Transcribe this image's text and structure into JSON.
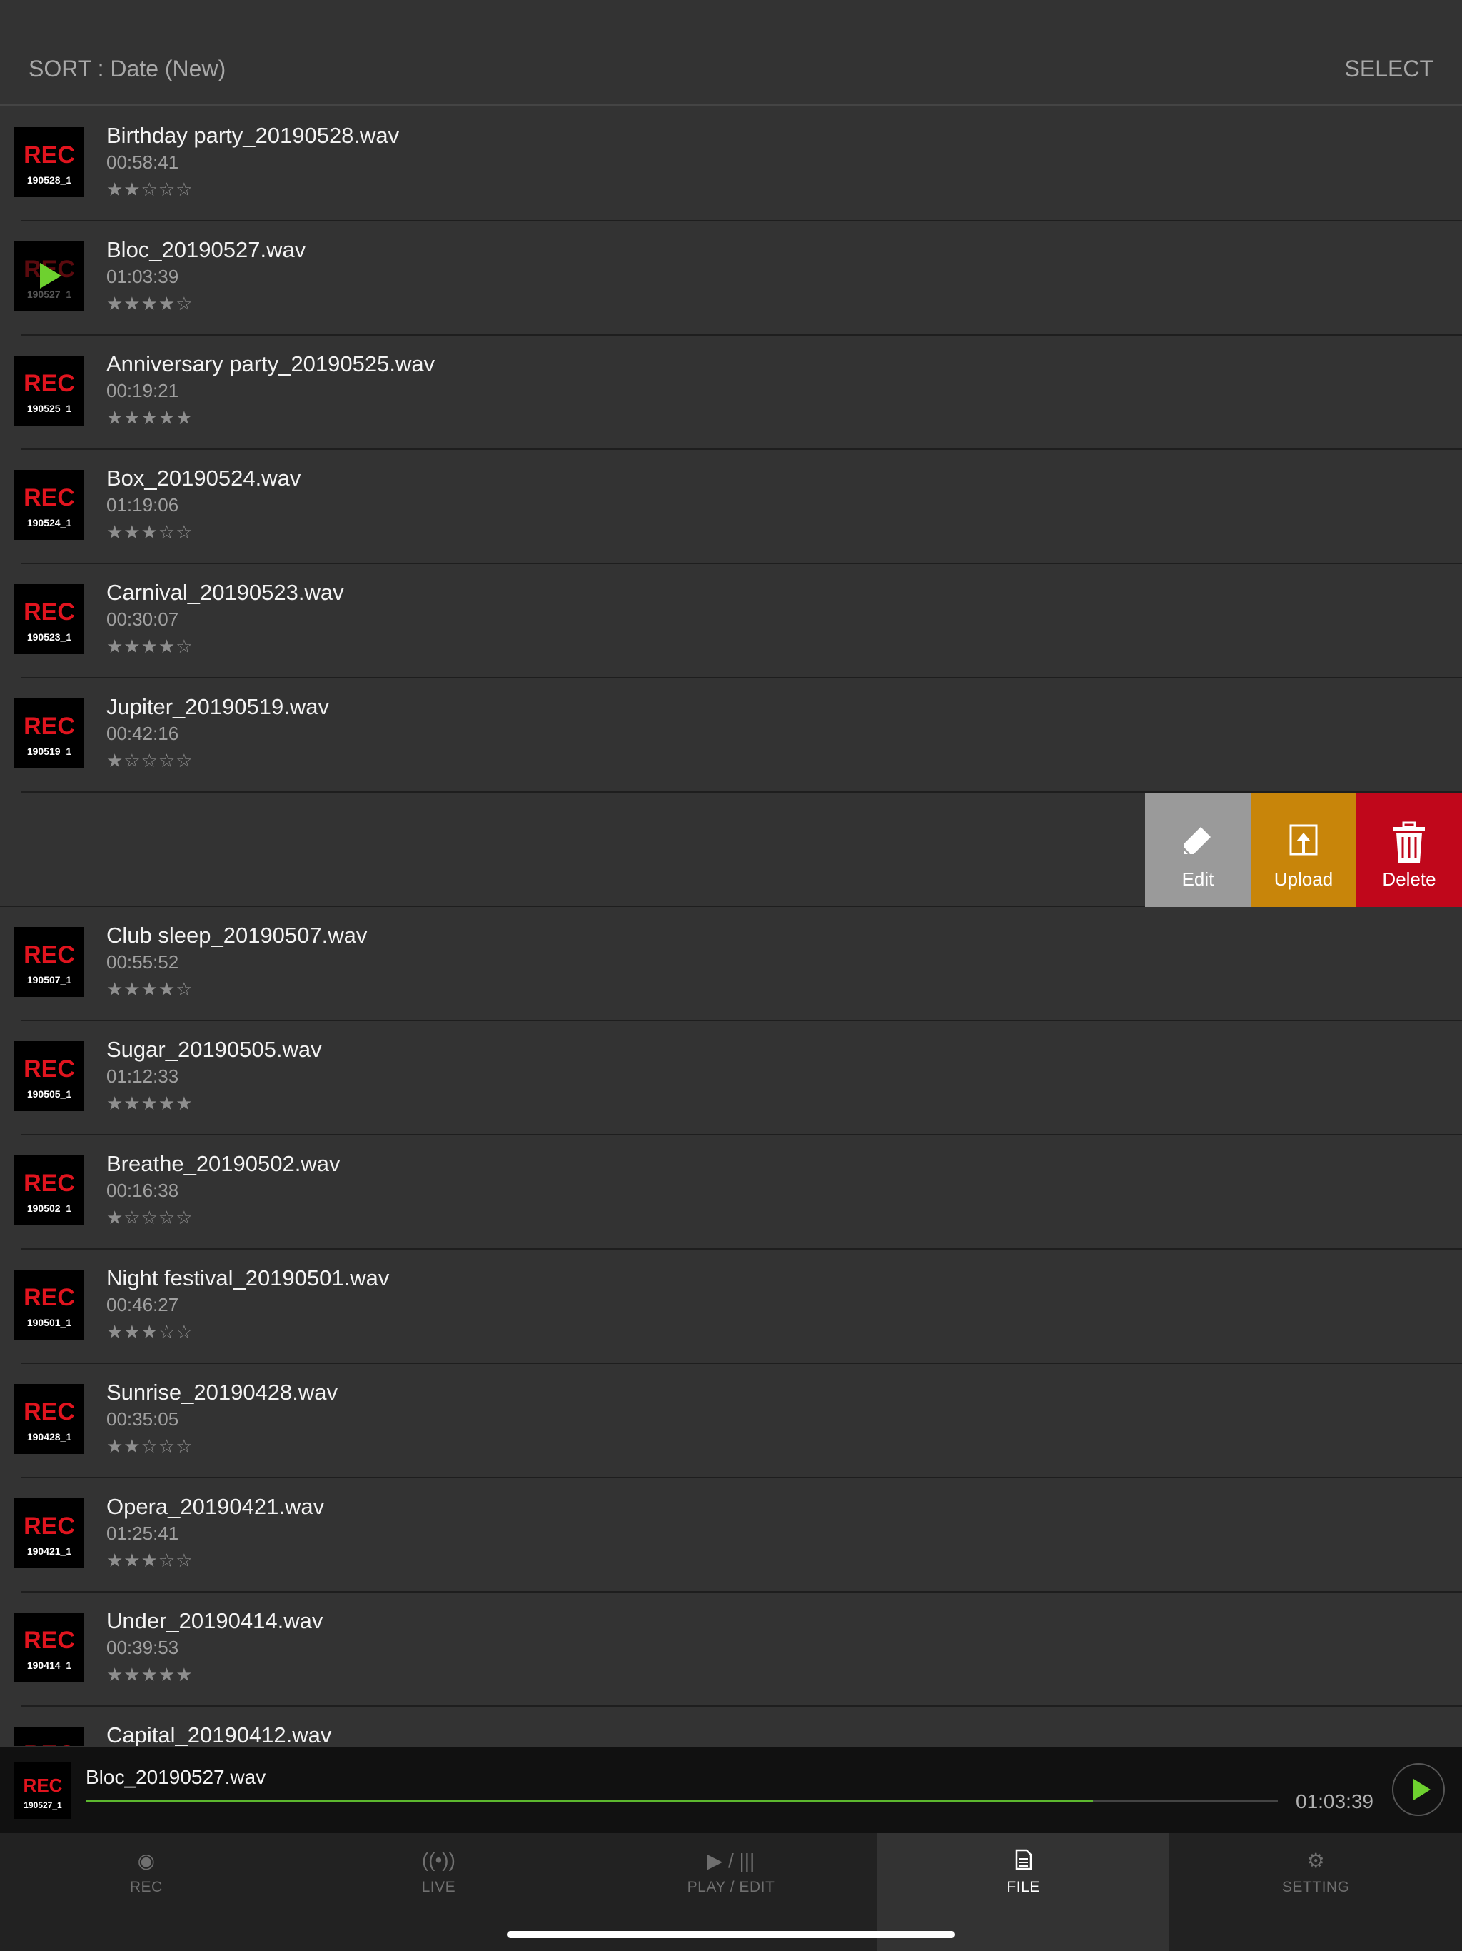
{
  "header": {
    "sort_label": "SORT : Date (New)",
    "select_label": "SELECT"
  },
  "files": [
    {
      "name": "Birthday party_20190528.wav",
      "duration": "00:58:41",
      "stars": "★★☆☆☆",
      "thumb_code": "190528_1"
    },
    {
      "name": "Bloc_20190527.wav",
      "duration": "01:03:39",
      "stars": "★★★★☆",
      "thumb_code": "190527_1",
      "playing": true
    },
    {
      "name": "Anniversary party_20190525.wav",
      "duration": "00:19:21",
      "stars": "★★★★★",
      "thumb_code": "190525_1"
    },
    {
      "name": "Box_20190524.wav",
      "duration": "01:19:06",
      "stars": "★★★☆☆",
      "thumb_code": "190524_1"
    },
    {
      "name": "Carnival_20190523.wav",
      "duration": "00:30:07",
      "stars": "★★★★☆",
      "thumb_code": "190523_1"
    },
    {
      "name": "Jupiter_20190519.wav",
      "duration": "00:42:16",
      "stars": "★☆☆☆☆",
      "thumb_code": "190519_1"
    },
    {
      "name": "Club sleep_20190507.wav",
      "duration": "00:55:52",
      "stars": "★★★★☆",
      "thumb_code": "190507_1"
    },
    {
      "name": "Sugar_20190505.wav",
      "duration": "01:12:33",
      "stars": "★★★★★",
      "thumb_code": "190505_1"
    },
    {
      "name": "Breathe_20190502.wav",
      "duration": "00:16:38",
      "stars": "★☆☆☆☆",
      "thumb_code": "190502_1"
    },
    {
      "name": "Night festival_20190501.wav",
      "duration": "00:46:27",
      "stars": "★★★☆☆",
      "thumb_code": "190501_1"
    },
    {
      "name": "Sunrise_20190428.wav",
      "duration": "00:35:05",
      "stars": "★★☆☆☆",
      "thumb_code": "190428_1"
    },
    {
      "name": "Opera_20190421.wav",
      "duration": "01:25:41",
      "stars": "★★★☆☆",
      "thumb_code": "190421_1"
    },
    {
      "name": "Under_20190414.wav",
      "duration": "00:39:53",
      "stars": "★★★★★",
      "thumb_code": "190414_1"
    },
    {
      "name": "Capital_20190412.wav",
      "duration": "",
      "stars": "",
      "thumb_code": ""
    }
  ],
  "thumb_label": "REC",
  "swipe_actions": {
    "edit": "Edit",
    "upload": "Upload",
    "delete": "Delete"
  },
  "player": {
    "file_name": "Bloc_20190527.wav",
    "time": "01:03:39",
    "thumb_code": "190527_1",
    "progress": 0.845
  },
  "tabs": [
    {
      "id": "rec",
      "label": "REC",
      "icon": "◉"
    },
    {
      "id": "live",
      "label": "LIVE",
      "icon": "((•))"
    },
    {
      "id": "play",
      "label": "PLAY / EDIT",
      "icon": "▶ / |||"
    },
    {
      "id": "file",
      "label": "FILE",
      "icon": "file-icon",
      "active": true
    },
    {
      "id": "setting",
      "label": "SETTING",
      "icon": "gear-icon"
    }
  ],
  "colors": {
    "rec_red": "#e0141e",
    "play_green": "#6ed12f",
    "edit": "#9a9a9a",
    "upload": "#c8850a",
    "delete": "#c0071b"
  }
}
